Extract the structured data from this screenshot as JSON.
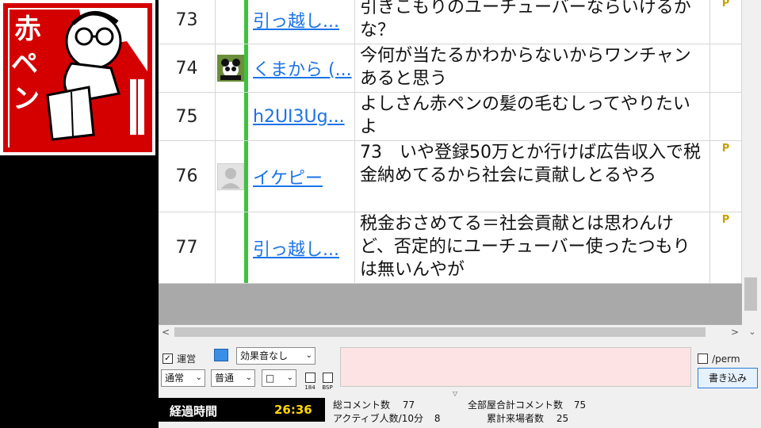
{
  "logo": {
    "text_parts": [
      "赤",
      "ペ",
      "ン"
    ],
    "color": "#d40000"
  },
  "comments": [
    {
      "no": "73",
      "name": "引っ越し...",
      "text": "引きこもりのユーチューバーならいけるかな？",
      "avatar": "none",
      "premium": true
    },
    {
      "no": "74",
      "name": "くまから (...",
      "text": "今何が当たるかわからないからワンチャンあると思う",
      "avatar": "panda",
      "premium": false
    },
    {
      "no": "75",
      "name": "h2UI3Ug...",
      "text": "よしさん赤ペンの髪の毛むしってやりたいよ",
      "avatar": "none",
      "premium": false
    },
    {
      "no": "76",
      "name": "イケピー",
      "text": "73　いや登録50万とか行けば広告収入で税金納めてるから社会に貢献しとるやろ",
      "avatar": "default",
      "premium": true
    },
    {
      "no": "77",
      "name": "引っ越し...",
      "text": "税金おさめてる＝社会貢献とは思わんけど、否定的にユーチューバー使ったつもりは無いんやが",
      "avatar": "none",
      "premium": true
    }
  ],
  "premium_badge": "P",
  "controls": {
    "unei_label": "運営",
    "unei_checked": true,
    "sound_select": "効果音なし",
    "size_select": "通常",
    "position_select": "普通",
    "color_select": "□",
    "check_184": "184",
    "check_bsp": "BSP",
    "perm_label": "/perm",
    "write_button": "書き込み",
    "comment_value": ""
  },
  "elapsed": {
    "label": "経過時間",
    "value": "26:36"
  },
  "stats": {
    "total_comments_label": "総コメント数",
    "total_comments": "77",
    "all_rooms_label": "全部屋合計コメント数",
    "all_rooms": "75",
    "active_label": "アクティブ人数/10分",
    "active": "8",
    "visitors_label": "累計来場者数",
    "visitors": "25"
  },
  "colors": {
    "accent_green": "#3ec23e",
    "link_blue": "#1a73e8",
    "elapsed_value": "#ffd700",
    "logo_red": "#d40000"
  }
}
